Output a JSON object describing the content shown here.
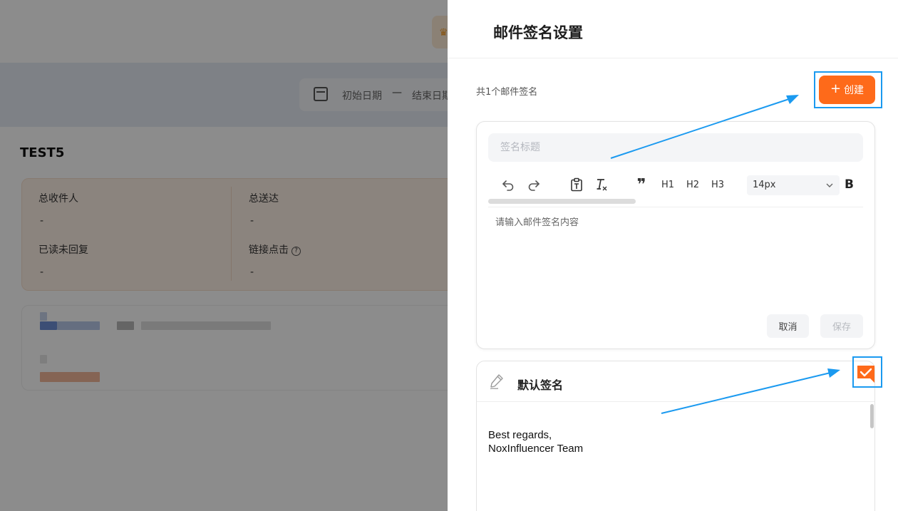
{
  "background": {
    "date_start": "初始日期",
    "date_separator": "—",
    "date_end": "结束日期",
    "campaign_title": "TEST5",
    "stats": [
      {
        "label": "总收件人",
        "value": "-"
      },
      {
        "label": "总送达",
        "value": "-"
      },
      {
        "label": "已读未回复",
        "value": "-"
      },
      {
        "label": "链接点击",
        "value": "-"
      }
    ]
  },
  "drawer": {
    "title": "邮件签名设置",
    "count_text": "共1个邮件签名",
    "create_label": "创建",
    "create_icon": "+",
    "editor": {
      "title_placeholder": "签名标题",
      "toolbar": {
        "quote_icon": "❞",
        "h1": "H1",
        "h2": "H2",
        "h3": "H3",
        "font_size": "14px",
        "bold": "B"
      },
      "content_placeholder": "请输入邮件签名内容",
      "cancel_label": "取消",
      "save_label": "保存"
    },
    "signature": {
      "name": "默认签名",
      "body_line1": "Best regards,",
      "body_line2": "NoxInfluencer Team"
    }
  },
  "colors": {
    "accent": "#fe6a1a",
    "annotation_blue": "#1b9af0"
  }
}
